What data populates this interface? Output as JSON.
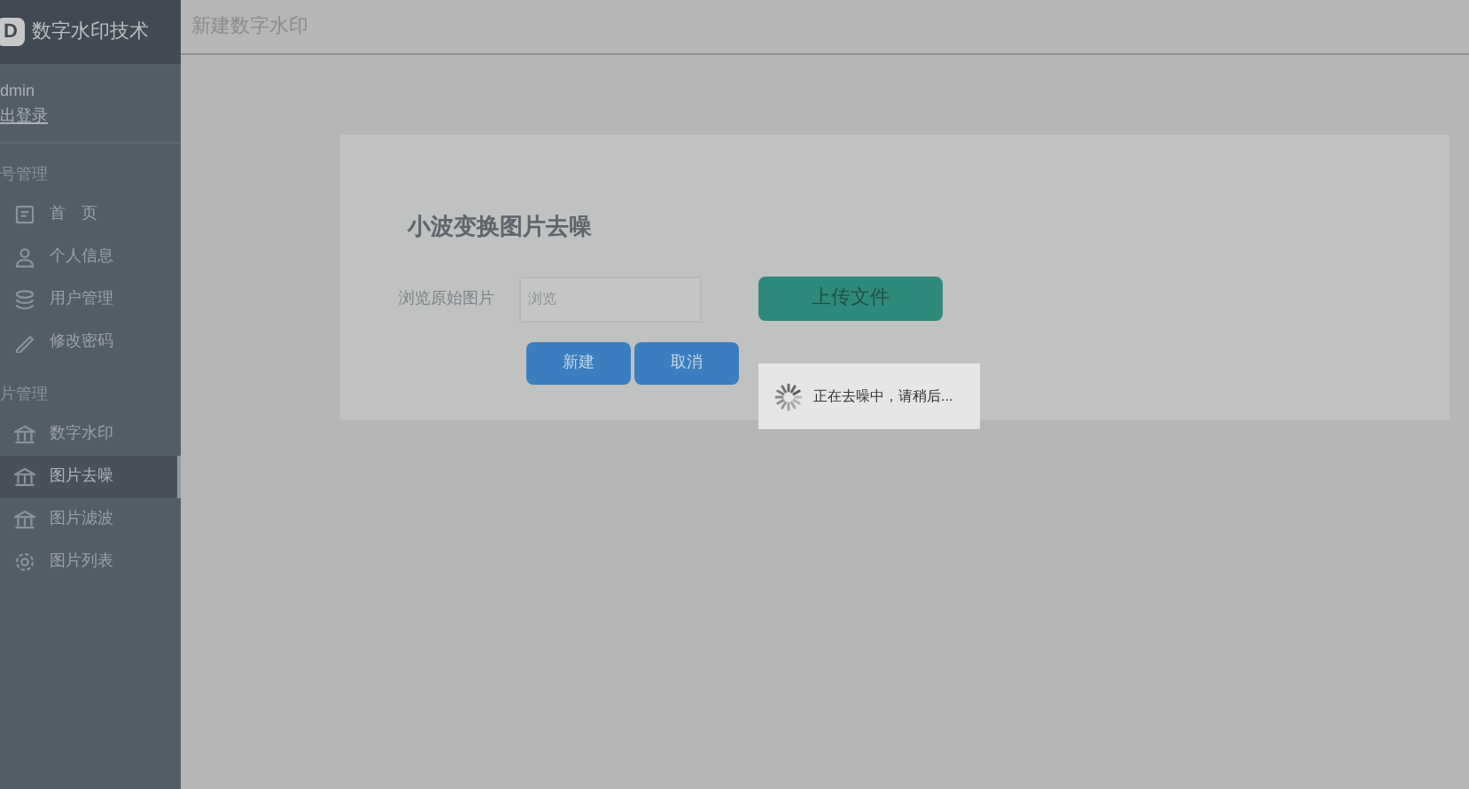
{
  "sidebar": {
    "logo_letter": "D",
    "title": "数字水印技术",
    "user": {
      "name": "dmin",
      "logout": "出登录"
    },
    "sections": [
      {
        "title": "号管理",
        "items": [
          {
            "label": "首　页",
            "kind": "home",
            "selected": false
          },
          {
            "label": "个人信息",
            "kind": "user",
            "selected": false
          },
          {
            "label": "用户管理",
            "kind": "layers",
            "selected": false
          },
          {
            "label": "修改密码",
            "kind": "pen",
            "selected": false
          }
        ]
      },
      {
        "title": "片管理",
        "items": [
          {
            "label": "数字水印",
            "kind": "bank",
            "selected": false
          },
          {
            "label": "图片去噪",
            "kind": "bank",
            "selected": true
          },
          {
            "label": "图片滤波",
            "kind": "bank",
            "selected": false
          },
          {
            "label": "图片列表",
            "kind": "gear",
            "selected": false
          }
        ]
      }
    ]
  },
  "header": {
    "title": "新建数字水印"
  },
  "form": {
    "title": "小波变换图片去噪",
    "field_label": "浏览原始图片",
    "placeholder": "浏览",
    "upload_button": "上传文件",
    "buttons": [
      "新建",
      "取消"
    ]
  },
  "loading": {
    "text": "正在去噪中，请稍后..."
  }
}
